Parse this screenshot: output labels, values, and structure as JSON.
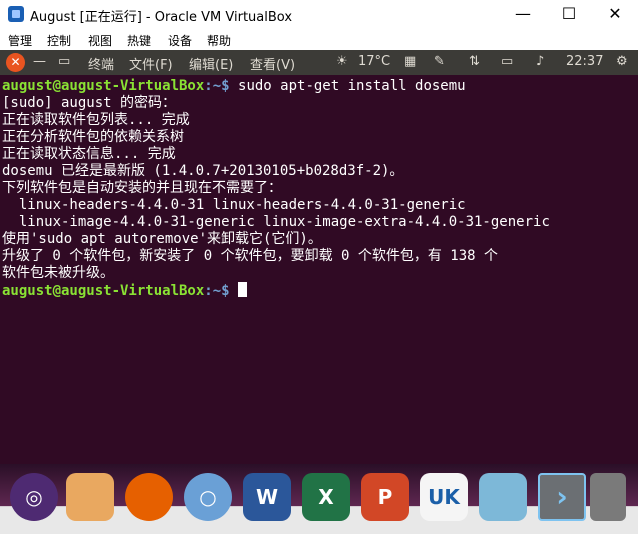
{
  "window": {
    "title": "August [正在运行] - Oracle VM VirtualBox",
    "minimize": "—",
    "maximize": "☐",
    "close": "✕"
  },
  "menu": [
    "管理",
    "控制",
    "视图",
    "热键",
    "设备",
    "帮助"
  ],
  "panel": {
    "app_name": "终端",
    "menus": [
      "文件(F)",
      "编辑(E)",
      "查看(V)"
    ],
    "temperature": "17°C",
    "time": "22:37",
    "icons": [
      "close-icon",
      "minimize-icon",
      "weather-icon",
      "keyboard-icon",
      "network-icon",
      "battery-icon",
      "volume-icon",
      "settings-gear-icon"
    ]
  },
  "terminal": {
    "prompt_user": "august@august-VirtualBox",
    "prompt_sep": ":~$ ",
    "command": "sudo apt-get install dosemu",
    "lines": [
      "[sudo] august 的密码：",
      "正在读取软件包列表... 完成",
      "正在分析软件包的依赖关系树",
      "正在读取状态信息... 完成",
      "dosemu 已经是最新版 (1.4.0.7+20130105+b028d3f-2)。",
      "下列软件包是自动安装的并且现在不需要了：",
      "  linux-headers-4.4.0-31 linux-headers-4.4.0-31-generic",
      "  linux-image-4.4.0-31-generic linux-image-extra-4.4.0-31-generic",
      "使用'sudo apt autoremove'来卸载它(它们)。",
      "升级了 0 个软件包，新安装了 0 个软件包，要卸载 0 个软件包，有 138 个",
      "软件包未被升级。"
    ]
  },
  "dock": [
    {
      "name": "ubuntu-launcher-icon",
      "glyph": "◎"
    },
    {
      "name": "files-icon",
      "glyph": ""
    },
    {
      "name": "firefox-icon",
      "glyph": ""
    },
    {
      "name": "chromium-icon",
      "glyph": "○"
    },
    {
      "name": "wps-writer-icon",
      "glyph": "W"
    },
    {
      "name": "wps-spreadsheet-icon",
      "glyph": "X"
    },
    {
      "name": "wps-presentation-icon",
      "glyph": "P"
    },
    {
      "name": "software-store-icon",
      "glyph": "UK"
    },
    {
      "name": "software-updater-icon",
      "glyph": ""
    },
    {
      "name": "launcher-next-icon",
      "glyph": "›"
    },
    {
      "name": "trash-icon",
      "glyph": ""
    }
  ]
}
